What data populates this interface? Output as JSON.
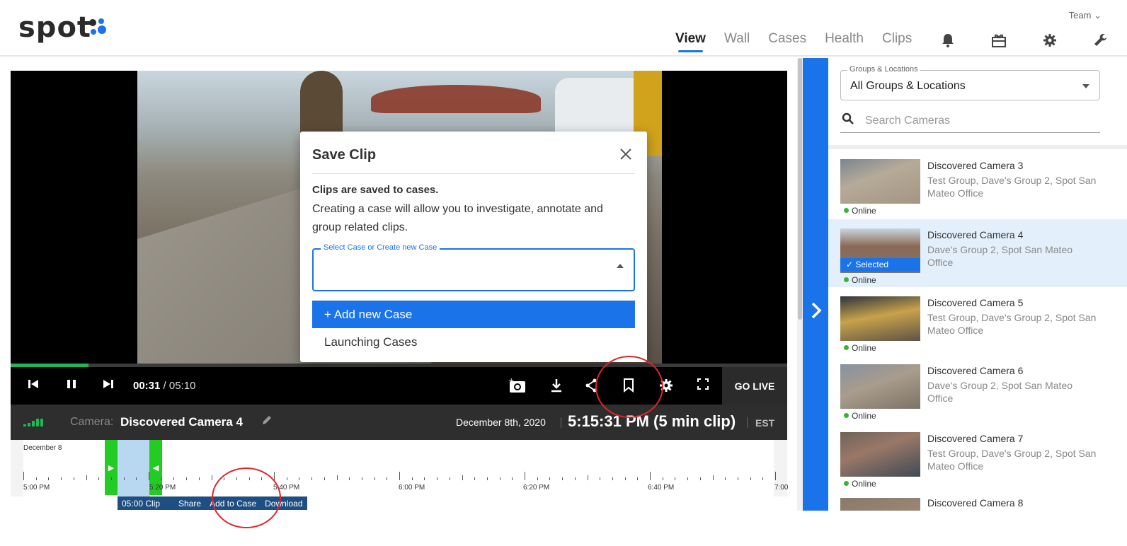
{
  "header": {
    "logo": "spot",
    "team_label": "Team",
    "nav": [
      {
        "label": "View",
        "active": true
      },
      {
        "label": "Wall",
        "active": false
      },
      {
        "label": "Cases",
        "active": false
      },
      {
        "label": "Health",
        "active": false
      },
      {
        "label": "Clips",
        "active": false
      }
    ],
    "icons": [
      "bell-icon",
      "gift-icon",
      "gear-icon",
      "wrench-icon"
    ]
  },
  "player": {
    "current_time": "00:31",
    "duration": " / 05:10",
    "progress_fraction": 0.1,
    "go_live": "GO LIVE"
  },
  "camera_bar": {
    "camera_label": "Camera:",
    "camera_name": "Discovered Camera 4",
    "date": "December 8th, 2020",
    "time": "5:15:31 PM (5 min clip)",
    "timezone": "EST"
  },
  "timeline": {
    "date_label": "December 8",
    "labels": [
      "5:00 PM",
      "5:20 PM",
      "5:40 PM",
      "6:00 PM",
      "6:20 PM",
      "6:40 PM",
      "7:00"
    ],
    "clip_label": "05:00 Clip",
    "actions": [
      "Share",
      "Add to Case",
      "Download"
    ]
  },
  "modal": {
    "title": "Save Clip",
    "bold_text": "Clips are saved to cases.",
    "body_text": "Creating a case will allow you to investigate, annotate and group related clips.",
    "select_label": "Select Case or Create new Case",
    "options": [
      "+ Add new Case",
      "Launching Cases"
    ]
  },
  "sidebar": {
    "groups_label": "Groups & Locations",
    "groups_value": "All Groups & Locations",
    "search_placeholder": "Search Cameras",
    "selected_badge": "Selected",
    "cameras": [
      {
        "name": "Discovered Camera 3",
        "groups": "Test Group, Dave's Group 2, Spot San Mateo Office",
        "status": "Online",
        "selected": false
      },
      {
        "name": "Discovered Camera 4",
        "groups": "Dave's Group 2, Spot San Mateo Office",
        "status": "Online",
        "selected": true
      },
      {
        "name": "Discovered Camera 5",
        "groups": "Test Group, Dave's Group 2, Spot San Mateo Office",
        "status": "Online",
        "selected": false
      },
      {
        "name": "Discovered Camera 6",
        "groups": "Dave's Group 2, Spot San Mateo Office",
        "status": "Online",
        "selected": false
      },
      {
        "name": "Discovered Camera 7",
        "groups": "Test Group, Dave's Group 2, Spot San Mateo Office",
        "status": "Online",
        "selected": false
      },
      {
        "name": "Discovered Camera 8",
        "groups": "",
        "status": "",
        "selected": false
      }
    ]
  },
  "colors": {
    "accent": "#1a73e8",
    "online": "#36b534",
    "clip_handle": "#22cc22",
    "annotation": "#e0242a"
  }
}
